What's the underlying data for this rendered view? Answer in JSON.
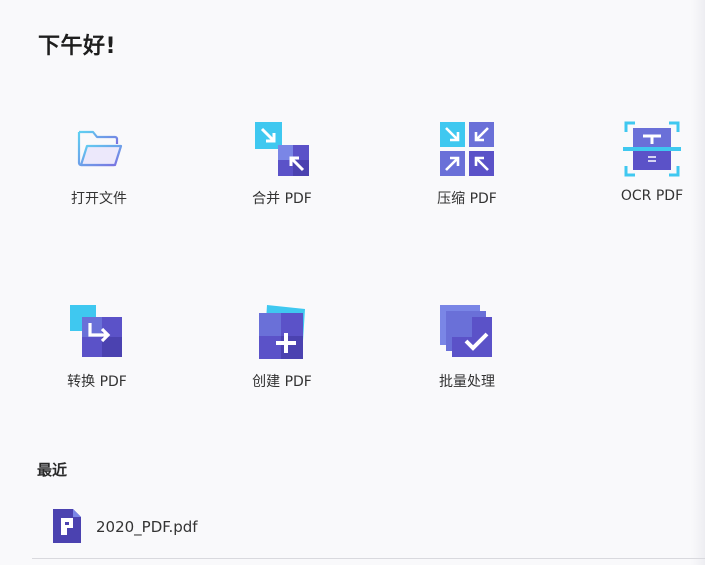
{
  "greeting": "下午好!",
  "actions": [
    {
      "label": "打开文件",
      "icon": "folder-icon"
    },
    {
      "label": "合并 PDF",
      "icon": "merge-icon"
    },
    {
      "label": "压缩 PDF",
      "icon": "compress-icon"
    },
    {
      "label": "OCR PDF",
      "icon": "ocr-icon"
    },
    {
      "label": "转换 PDF",
      "icon": "convert-icon"
    },
    {
      "label": "创建 PDF",
      "icon": "create-icon"
    },
    {
      "label": "批量处理",
      "icon": "batch-icon"
    }
  ],
  "recent": {
    "title": "最近",
    "files": [
      {
        "name": "2020_PDF.pdf",
        "icon": "pdf-file-icon"
      }
    ]
  },
  "colors": {
    "accent": "#5b52c8",
    "accent_light": "#7a86e6",
    "cyan": "#3fc8f0"
  }
}
